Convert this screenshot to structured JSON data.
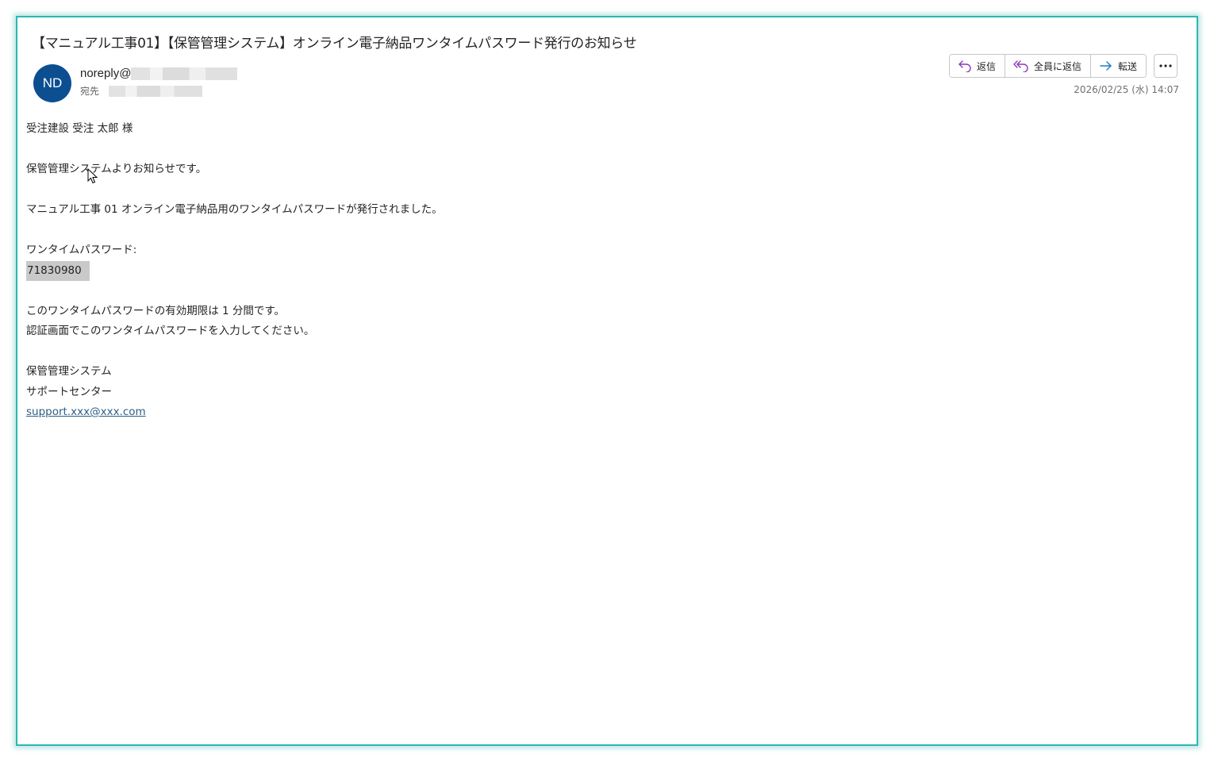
{
  "email": {
    "subject": "【マニュアル工事01】【保管管理システム】オンライン電子納品ワンタイムパスワード発行のお知らせ",
    "avatar_initials": "ND",
    "sender": "noreply@",
    "to_label": "宛先",
    "date": "2026/02/25 (水) 14:07",
    "actions": {
      "reply": "返信",
      "reply_all": "全員に返信",
      "forward": "転送"
    },
    "body": {
      "greeting": "受注建設 受注 太郎 様",
      "intro": "保管管理システムよりお知らせです。",
      "notice": "マニュアル工事 01 オンライン電子納品用のワンタイムパスワードが発行されました。",
      "otp_label": "ワンタイムパスワード:",
      "otp_value": "71830980",
      "validity": "このワンタイムパスワードの有効期限は 1 分間です。",
      "instruction": "認証画面でこのワンタイムパスワードを入力してください。",
      "signature_system": "保管管理システム",
      "signature_center": "サポートセンター",
      "signature_email": "support.xxx@xxx.com"
    }
  },
  "colors": {
    "frame_border": "#2bb8b3",
    "avatar_bg": "#0b4f91",
    "reply_icon": "#8a3ab9",
    "forward_icon": "#1b7fbf",
    "link": "#2e5f86"
  }
}
